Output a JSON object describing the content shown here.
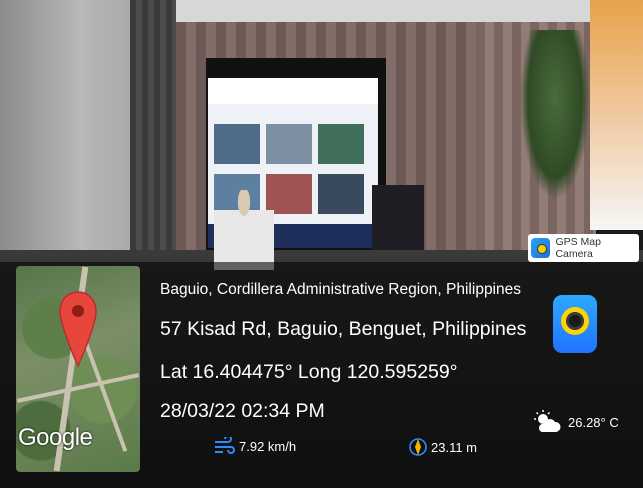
{
  "app": {
    "badge_label": "GPS Map Camera"
  },
  "map": {
    "brand": "Google"
  },
  "location": {
    "city": "Baguio, Cordillera Administrative Region, Philippines",
    "address": "57 Kisad Rd, Baguio, Benguet, Philippines",
    "coordinates": "Lat 16.404475° Long 120.595259°",
    "datetime": "28/03/22 02:34 PM"
  },
  "metrics": {
    "wind": "7.92 km/h",
    "altitude": "23.11 m",
    "temperature": "26.28° C"
  },
  "icons": {
    "pin": "map-pin-icon",
    "wind": "wind-icon",
    "altitude": "compass-icon",
    "weather": "partly-cloudy-icon"
  },
  "colors": {
    "pin": "#e8453c",
    "accent_blue": "#2a8cff",
    "overlay_text": "#ffffff"
  }
}
